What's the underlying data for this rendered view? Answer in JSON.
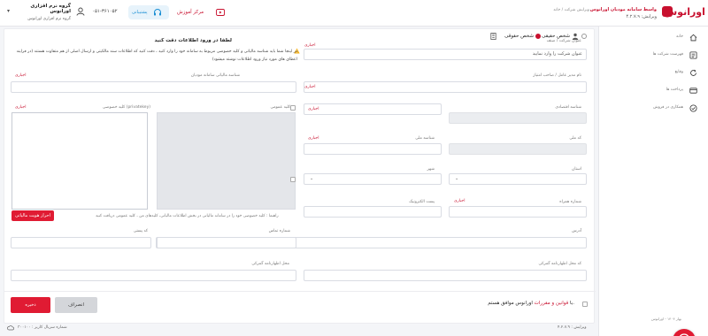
{
  "header": {
    "brand_logo_text": "اورانوس",
    "brand_title": "واسط سامانه مودیان اورانوس",
    "brand_version": "ویرایش: ۴.۲.۷.۹",
    "breadcrumb": "ویرایش شرکت  /  خانه",
    "training_label": "مرکز آموزش",
    "support_label": "پشتیبانی",
    "phone": "۰۵۱-۳۶۱۰۵۲",
    "company_name": "گروه نرم افزاری اورانوس",
    "company_sub": "گروه نرم افزاری اورانوس"
  },
  "sidebar": {
    "items": [
      {
        "label": "خانه",
        "icon": "home-icon"
      },
      {
        "label": "فهرست شرکت ها",
        "icon": "list-icon"
      },
      {
        "label": "وقایع",
        "icon": "refresh-icon"
      },
      {
        "label": "پرداخت ها",
        "icon": "wallet-icon"
      },
      {
        "label": "همکاری در فروش",
        "icon": "coop-icon"
      }
    ],
    "footer": "بهار ۱۴۰۴ - اورانوس"
  },
  "form": {
    "radio_real": "شخص حقیقی",
    "radio_legal": "شخص حقوقی",
    "company_title_label": "عنوان شرکت / صنف",
    "company_title_placeholder": "عنوان شرکت را وارد نمایید",
    "required": "اجباری",
    "ceo_label": "نام مدیر عامل / صاحب امتیاز",
    "econ_id_label": "شناسه اقتصادی",
    "reg_no_label": "شماره ثبت / جواز کسب",
    "national_id_label": "شناسه ملی",
    "code_label": "کد ملی",
    "province_label": "استان",
    "city_label": "شهر",
    "mobile_label": "شماره همراه",
    "email_label": "پست الکترونیک",
    "address_label": "آدرس",
    "phone_label": "شماره تماس",
    "postal_label": "کد پستی",
    "customs_code_label": "کد محل اظهارنامه گمرکی",
    "customs_place_label": "محل اظهارنامه گمرکی",
    "tax_memory_label": "شناسه مالیاتی سامانه مودیان",
    "public_key_label": "کلید عمومی",
    "private_key_label": "کلید خصوصی (privatekey)",
    "warning_title": "لطفا در ورود اطلاعات دقت کنید",
    "warning_text": "در اینجا شما باید شناسه مالیاتی و کلید خصوصی مربوط به سامانه خود را وارد کنید ، دقت کنید که اطلاعات سند مالکیتی و ارسال اصلی از هم متفاوت هستند (در فرایند اعطای های مورد نیاز ورود اطلاعات نوشته میشود)",
    "guide_text": "راهنما :   کلید خصوصی خود را در سامانه مالیاتی در بخش اطلاعات مالیاتی، کلیدهای من ، کلید عمومی دریافت کنید",
    "generate_button": "احراز هویت مالیاتی",
    "terms_prefix": "با ",
    "terms_link": "قوانین و مقررات",
    "terms_suffix": " اورانوس موافق هستم.",
    "cancel_button": "انصراف",
    "save_button": "ذخیره"
  },
  "footer": {
    "version": "ویرایش : ۴.۲.۷.۹",
    "serial": "شماره سریال کاربر : ۳۰۰۱۰۰"
  }
}
